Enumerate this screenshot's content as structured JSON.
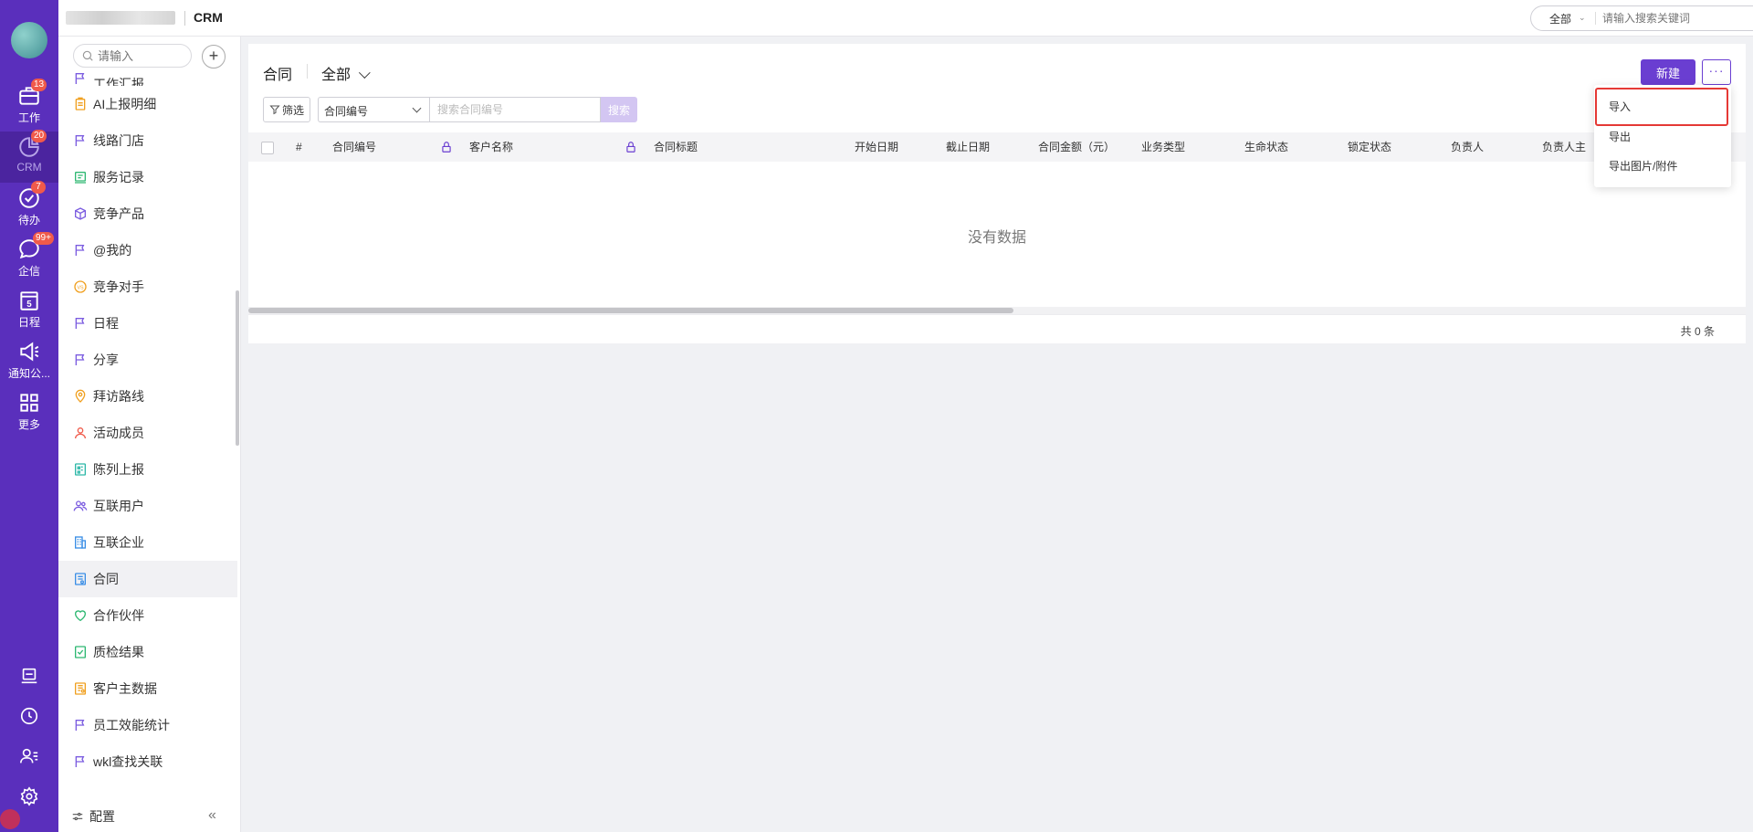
{
  "rail": {
    "items": [
      {
        "label": "工作",
        "badge": "13",
        "icon": "briefcase-icon"
      },
      {
        "label": "CRM",
        "badge": "20",
        "icon": "pie-chart-icon"
      },
      {
        "label": "待办",
        "badge": "7",
        "icon": "check-circle-icon"
      },
      {
        "label": "企信",
        "badge": "99+",
        "icon": "chat-bubble-icon"
      },
      {
        "label": "日程",
        "badge": "",
        "icon": "calendar-icon",
        "calendar_day": "5"
      },
      {
        "label": "通知公...",
        "badge": "",
        "icon": "megaphone-icon"
      },
      {
        "label": "更多",
        "badge": "",
        "icon": "grid-icon"
      }
    ],
    "bottom_icons": [
      "inbox-icon",
      "clock-icon",
      "user-list-icon",
      "settings-icon"
    ]
  },
  "topbar": {
    "app_name": "CRM",
    "search_scope": "全部",
    "search_placeholder": "请输入搜索关键词"
  },
  "sidebar": {
    "search_placeholder": "请输入",
    "add_label": "+",
    "partial_item": "工作汇报",
    "items": [
      {
        "label": "AI上报明细",
        "icon": "clipboard-icon",
        "color": "#f0a020"
      },
      {
        "label": "线路门店",
        "icon": "flag-icon",
        "color": "#7b5ce0"
      },
      {
        "label": "服务记录",
        "icon": "service-record-icon",
        "color": "#2eb872"
      },
      {
        "label": "竞争产品",
        "icon": "box-icon",
        "color": "#7b5ce0"
      },
      {
        "label": "@我的",
        "icon": "flag-icon",
        "color": "#7b5ce0"
      },
      {
        "label": "竞争对手",
        "icon": "vs-icon",
        "color": "#f0a020"
      },
      {
        "label": "日程",
        "icon": "flag-icon",
        "color": "#7b5ce0"
      },
      {
        "label": "分享",
        "icon": "flag-icon",
        "color": "#7b5ce0"
      },
      {
        "label": "拜访路线",
        "icon": "location-icon",
        "color": "#f0a020"
      },
      {
        "label": "活动成员",
        "icon": "person-icon",
        "color": "#f05a4a"
      },
      {
        "label": "陈列上报",
        "icon": "display-report-icon",
        "color": "#2eb8a8"
      },
      {
        "label": "互联用户",
        "icon": "users-icon",
        "color": "#7b5ce0"
      },
      {
        "label": "互联企业",
        "icon": "building-icon",
        "color": "#3a8ee6"
      },
      {
        "label": "合同",
        "icon": "contract-icon",
        "color": "#3a8ee6",
        "active": true
      },
      {
        "label": "合作伙伴",
        "icon": "heart-icon",
        "color": "#2eb872"
      },
      {
        "label": "质检结果",
        "icon": "quality-check-icon",
        "color": "#2eb872"
      },
      {
        "label": "客户主数据",
        "icon": "customer-data-icon",
        "color": "#f0a020"
      },
      {
        "label": "员工效能统计",
        "icon": "flag-icon",
        "color": "#7b5ce0"
      },
      {
        "label": "wkl查找关联",
        "icon": "flag-icon",
        "color": "#7b5ce0"
      }
    ],
    "footer_label": "配置",
    "collapse_label": "«"
  },
  "main": {
    "title": "合同",
    "view": "全部",
    "new_button": "新建",
    "more_button": "···",
    "filter_label": "筛选",
    "field_select": "合同编号",
    "search_placeholder": "搜索合同编号",
    "search_button": "搜索",
    "columns": [
      "#",
      "合同编号",
      "客户名称",
      "合同标题",
      "开始日期",
      "截止日期",
      "合同金额（元）",
      "业务类型",
      "生命状态",
      "锁定状态",
      "负责人",
      "负责人主"
    ],
    "empty_text": "没有数据",
    "total_text": "共 0 条"
  },
  "dropdown": {
    "items": [
      "导入",
      "导出",
      "导出图片/附件"
    ]
  },
  "colors": {
    "rail_bg": "#5a2fbc",
    "accent": "#6a3ed1",
    "badge": "#f05a4a",
    "highlight_border": "#e53935"
  }
}
